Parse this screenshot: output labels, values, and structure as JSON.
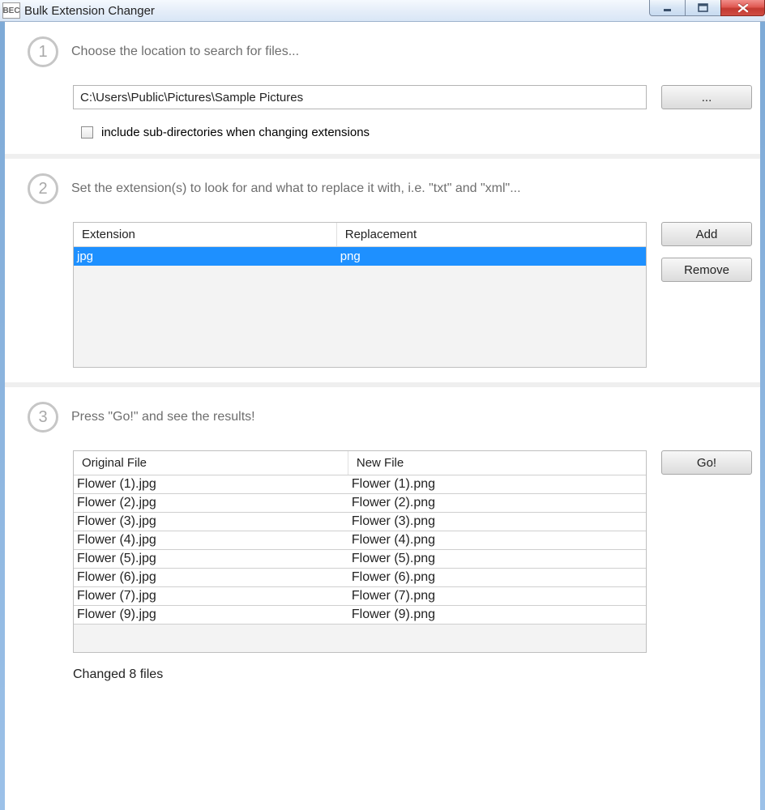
{
  "window": {
    "icon_text": "BEC",
    "title": "Bulk Extension Changer"
  },
  "step1": {
    "num": "1",
    "heading": "Choose the location to search for files...",
    "path": "C:\\Users\\Public\\Pictures\\Sample Pictures",
    "browse_label": "...",
    "checkbox_label": "include sub-directories when changing extensions"
  },
  "step2": {
    "num": "2",
    "heading": "Set the extension(s) to look for and what to replace it with, i.e. \"txt\" and \"xml\"...",
    "col_ext": "Extension",
    "col_rep": "Replacement",
    "rows": [
      {
        "ext": "jpg",
        "rep": "png"
      }
    ],
    "add_label": "Add",
    "remove_label": "Remove"
  },
  "step3": {
    "num": "3",
    "heading": "Press \"Go!\" and see the results!",
    "col_orig": "Original File",
    "col_new": "New File",
    "go_label": "Go!",
    "rows": [
      {
        "orig": "Flower (1).jpg",
        "new": "Flower (1).png"
      },
      {
        "orig": "Flower (2).jpg",
        "new": "Flower (2).png"
      },
      {
        "orig": "Flower (3).jpg",
        "new": "Flower (3).png"
      },
      {
        "orig": "Flower (4).jpg",
        "new": "Flower (4).png"
      },
      {
        "orig": "Flower (5).jpg",
        "new": "Flower (5).png"
      },
      {
        "orig": "Flower (6).jpg",
        "new": "Flower (6).png"
      },
      {
        "orig": "Flower (7).jpg",
        "new": "Flower (7).png"
      },
      {
        "orig": "Flower (9).jpg",
        "new": "Flower (9).png"
      }
    ],
    "status": "Changed 8 files"
  }
}
